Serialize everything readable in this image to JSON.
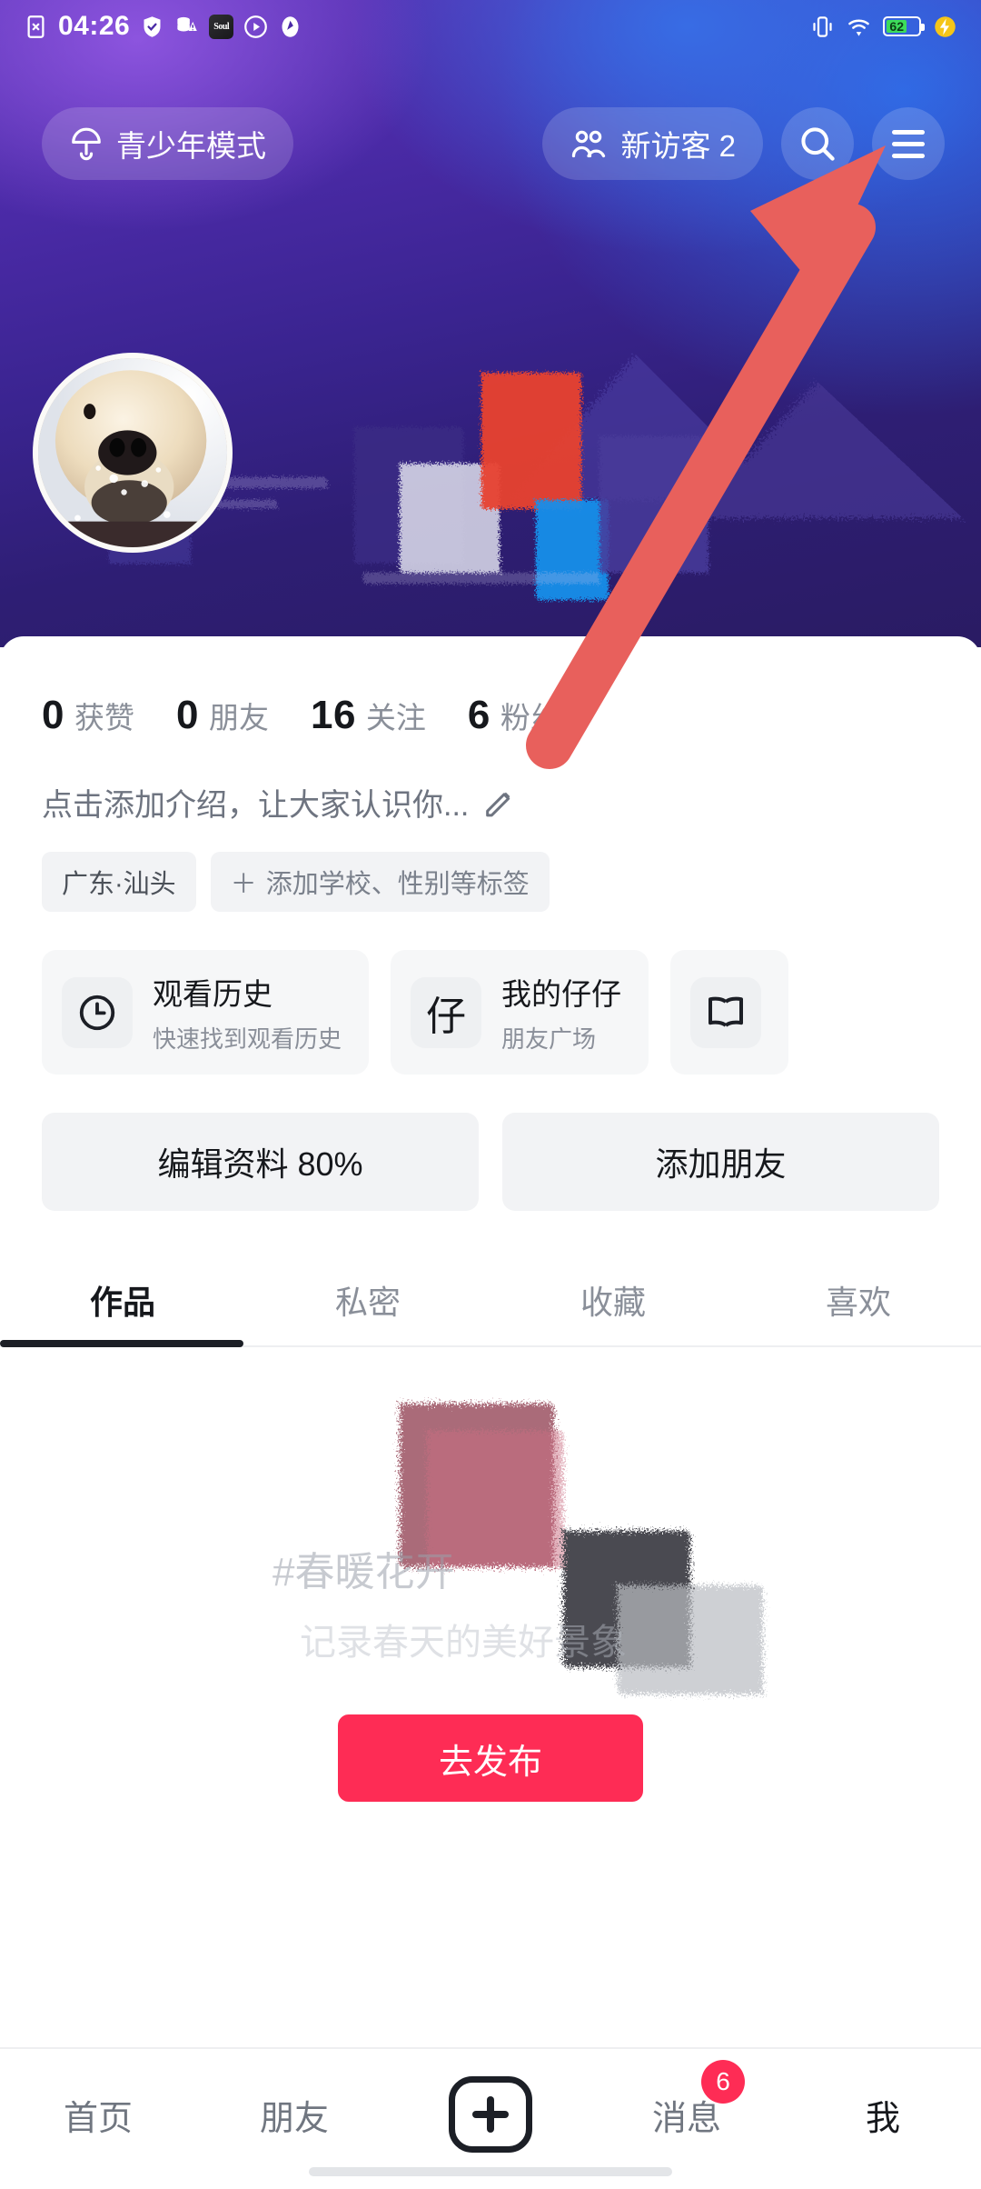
{
  "status_bar": {
    "time": "04:26",
    "battery_level": "62",
    "left_icons": [
      "sim-off-icon",
      "shield-icon",
      "vpn-icon",
      "soul-app-icon",
      "play-circle-icon",
      "compass-icon"
    ],
    "right_icons": [
      "vibrate-icon",
      "wifi-icon",
      "battery-icon",
      "charging-bolt-icon"
    ],
    "app_icon_label": "Soul"
  },
  "header": {
    "teen_mode_label": "青少年模式",
    "visitor_label": "新访客 2",
    "search_icon": "search-icon",
    "menu_icon": "hamburger-menu-icon"
  },
  "profile": {
    "avatar_alt": "dog-avatar",
    "stats": [
      {
        "value": "0",
        "label": "获赞"
      },
      {
        "value": "0",
        "label": "朋友"
      },
      {
        "value": "16",
        "label": "关注"
      },
      {
        "value": "6",
        "label": "粉丝"
      }
    ],
    "bio_placeholder": "点击添加介绍，让大家认识你...",
    "bio_edit_icon": "pencil-icon",
    "tags": [
      {
        "label": "广东·汕头",
        "has_plus": false
      },
      {
        "label": "添加学校、性别等标签",
        "has_plus": true
      }
    ]
  },
  "cards": [
    {
      "icon": "clock-icon",
      "icon_text": "",
      "title": "观看历史",
      "subtitle": "快速找到观看历史"
    },
    {
      "icon": "zai-character-icon",
      "icon_text": "仔",
      "title": "我的仔仔",
      "subtitle": "朋友广场"
    },
    {
      "icon": "book-icon",
      "icon_text": "",
      "title": "",
      "subtitle": ""
    }
  ],
  "actions": {
    "edit_profile_label": "编辑资料 80%",
    "add_friend_label": "添加朋友"
  },
  "tabs": [
    {
      "label": "作品",
      "active": true
    },
    {
      "label": "私密",
      "active": false
    },
    {
      "label": "收藏",
      "active": false
    },
    {
      "label": "喜欢",
      "active": false
    }
  ],
  "feed": {
    "banner_title": "#春暖花开",
    "banner_subtitle": "记录春天的美好景象",
    "publish_label": "去发布"
  },
  "bottom_nav": [
    {
      "label": "首页",
      "active": false,
      "badge": ""
    },
    {
      "label": "朋友",
      "active": false,
      "badge": ""
    },
    {
      "label": "",
      "active": false,
      "badge": "",
      "icon": "plus-box-icon"
    },
    {
      "label": "消息",
      "active": false,
      "badge": "6"
    },
    {
      "label": "我",
      "active": true,
      "badge": ""
    }
  ],
  "annotation": {
    "arrow_color": "#e8605c",
    "arrow_target": "hamburger-menu-icon"
  },
  "colors": {
    "accent_red": "#fe2c55",
    "text_primary": "#16181c",
    "text_secondary": "#8a8f99",
    "chip_bg": "#f2f3f5"
  }
}
